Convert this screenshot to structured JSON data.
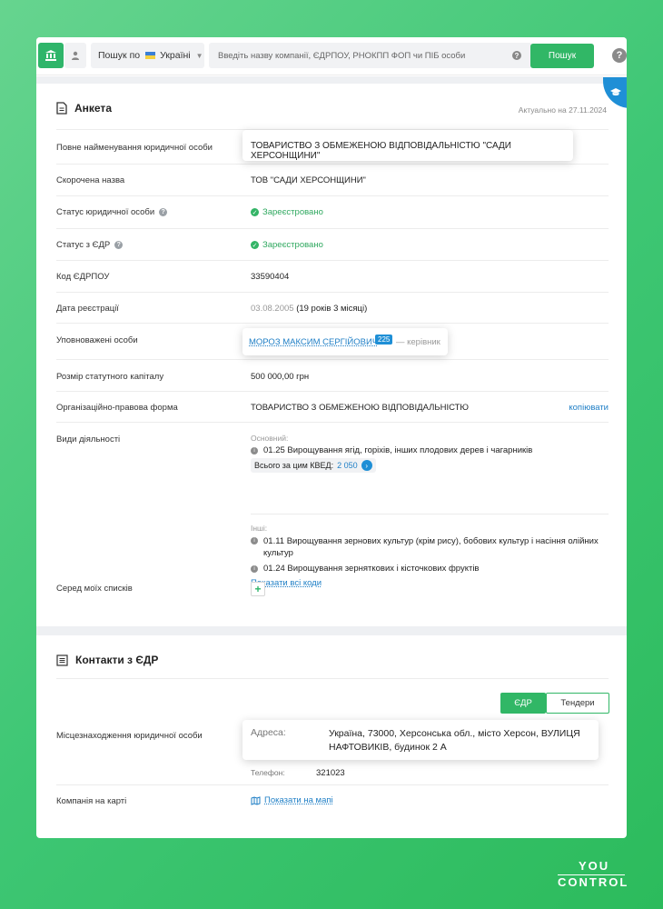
{
  "search": {
    "scope_prefix": "Пошук по",
    "country": "Україні",
    "placeholder": "Введіть назву компанії, ЄДРПОУ, РНОКПП ФОП чи ПІБ особи",
    "button": "Пошук"
  },
  "anketa": {
    "title": "Анкета",
    "actual": "Актуально на 27.11.2024",
    "rows": {
      "full_name": {
        "label": "Повне найменування юридичної особи",
        "value": "ТОВАРИСТВО З ОБМЕЖЕНОЮ ВІДПОВІДАЛЬНІСТЮ \"САДИ ХЕРСОНЩИНИ\""
      },
      "short_name": {
        "label": "Скорочена назва",
        "value": "ТОВ \"САДИ ХЕРСОНЩИНИ\""
      },
      "legal_status": {
        "label": "Статус юридичної особи",
        "value": "Зареєстровано"
      },
      "edr_status": {
        "label": "Статус з ЄДР",
        "value": "Зареєстровано"
      },
      "edrpou": {
        "label": "Код ЄДРПОУ",
        "value": "33590404"
      },
      "reg_date": {
        "label": "Дата реєстрації",
        "date": "03.08.2005",
        "age": "(19 років 3 місяці)"
      },
      "authorized": {
        "label": "Уповноважені особи",
        "name": "МОРОЗ МАКСИМ СЕРГІЙОВИЧ",
        "badge": "225",
        "role": "— керівник"
      },
      "capital": {
        "label": "Розмір статутного капіталу",
        "value": "500 000,00 грн"
      },
      "legal_form": {
        "label": "Організаційно-правова форма",
        "value": "ТОВАРИСТВО З ОБМЕЖЕНОЮ ВІДПОВІДАЛЬНІСТЮ",
        "copy": "копіювати"
      },
      "activities": {
        "label": "Види діяльності",
        "main_title": "Основний:",
        "main": "01.25 Вирощування ягід, горіхів, інших плодових дерев і чагарників",
        "total_label": "Всього за цим КВЕД:",
        "total_value": "2 050",
        "other_title": "Інші:",
        "other": [
          "01.11 Вирощування зернових культур (крім рису), бобових культур і насіння олійних культур",
          "01.24 Вирощування зерняткових і кісточкових фруктів"
        ],
        "show_all": "Показати всі коди"
      },
      "my_lists": {
        "label": "Серед моїх списків"
      }
    }
  },
  "contacts": {
    "title": "Контакти з ЄДР",
    "tabs": [
      "ЄДР",
      "Тендери"
    ],
    "location_label": "Місцезнаходження юридичної особи",
    "address_label": "Адреса:",
    "address_value": "Україна, 73000, Херсонська обл., місто Херсон, ВУЛИЦЯ НАФТОВИКІВ, будинок 2 А",
    "phone_label": "Телефон:",
    "phone_value": "321023",
    "map_label": "Компанія на карті",
    "map_link": "Показати на мапі"
  },
  "brand": {
    "line1": "YOU",
    "line2": "CONTROL"
  },
  "colors": {
    "accent": "#31b766",
    "link": "#1f7fc6",
    "badge": "#1f8fd6"
  }
}
